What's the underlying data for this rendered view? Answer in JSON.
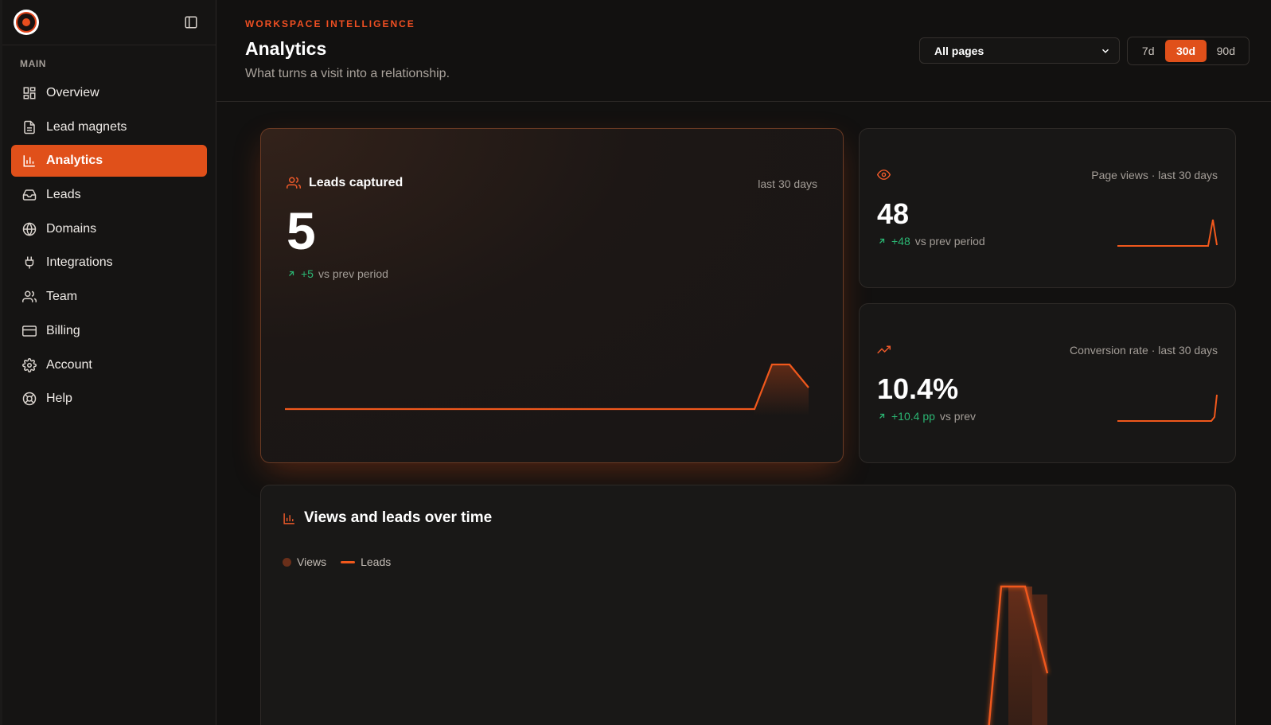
{
  "sidebar": {
    "section_label": "MAIN",
    "items": [
      {
        "label": "Overview",
        "icon": "grid-icon"
      },
      {
        "label": "Lead magnets",
        "icon": "document-icon"
      },
      {
        "label": "Analytics",
        "icon": "bar-chart-icon",
        "active": true
      },
      {
        "label": "Leads",
        "icon": "inbox-icon"
      },
      {
        "label": "Domains",
        "icon": "globe-icon"
      },
      {
        "label": "Integrations",
        "icon": "plug-icon"
      },
      {
        "label": "Team",
        "icon": "users-icon"
      },
      {
        "label": "Billing",
        "icon": "credit-card-icon"
      },
      {
        "label": "Account",
        "icon": "gear-icon"
      },
      {
        "label": "Help",
        "icon": "lifebuoy-icon"
      }
    ]
  },
  "header": {
    "eyebrow": "WORKSPACE INTELLIGENCE",
    "title": "Analytics",
    "subtitle": "What turns a visit into a relationship.",
    "page_filter": "All pages",
    "ranges": [
      "7d",
      "30d",
      "90d"
    ],
    "active_range": "30d"
  },
  "leads_card": {
    "title": "Leads captured",
    "period": "last 30 days",
    "value": "5",
    "delta": "+5",
    "delta_suffix": "vs prev period"
  },
  "views_card": {
    "label": "Page views · last 30 days",
    "value": "48",
    "delta": "+48",
    "delta_suffix": "vs prev period"
  },
  "conversion_card": {
    "label": "Conversion rate · last 30 days",
    "value": "10.4%",
    "delta": "+10.4 pp",
    "delta_suffix": "vs prev"
  },
  "chart": {
    "title": "Views and leads over time",
    "legend": [
      "Views",
      "Leads"
    ]
  },
  "colors": {
    "accent": "#e0501a",
    "positive": "#2bb673",
    "background": "#121110"
  }
}
